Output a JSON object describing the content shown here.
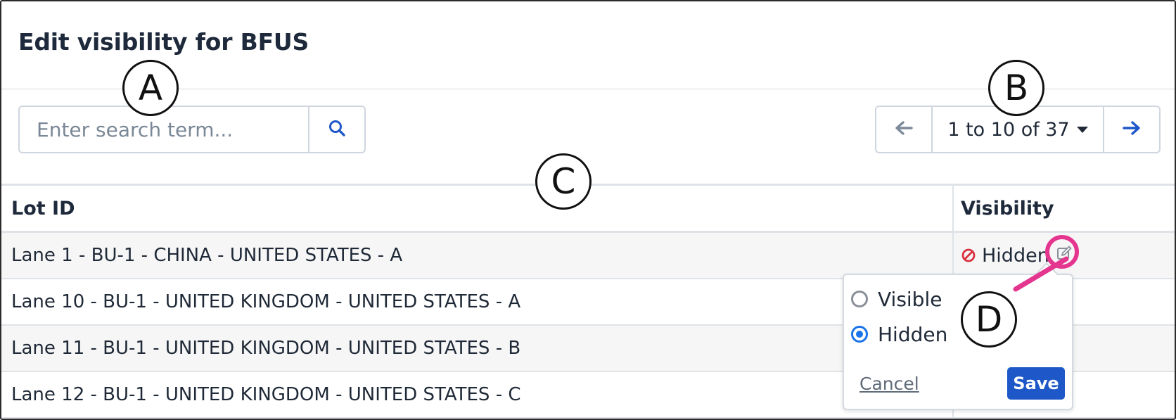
{
  "page": {
    "title": "Edit visibility for BFUS"
  },
  "search": {
    "placeholder": "Enter search term...",
    "value": ""
  },
  "pagination": {
    "range_label": "1 to 10 of 37"
  },
  "table": {
    "headers": {
      "lot_id": "Lot ID",
      "visibility": "Visibility"
    },
    "rows": [
      {
        "lot_id": "Lane 1 - BU-1 - CHINA - UNITED STATES - A",
        "visibility": "Hidden"
      },
      {
        "lot_id": "Lane 10 - BU-1 - UNITED KINGDOM - UNITED STATES - A",
        "visibility": ""
      },
      {
        "lot_id": "Lane 11 - BU-1 - UNITED KINGDOM - UNITED STATES - B",
        "visibility": ""
      },
      {
        "lot_id": "Lane 12 - BU-1 - UNITED KINGDOM - UNITED STATES - C",
        "visibility": ""
      }
    ]
  },
  "popover": {
    "options": [
      {
        "label": "Visible",
        "selected": false
      },
      {
        "label": "Hidden",
        "selected": true
      }
    ],
    "cancel_label": "Cancel",
    "save_label": "Save"
  },
  "callouts": {
    "a": "A",
    "b": "B",
    "c": "C",
    "d": "D"
  },
  "colors": {
    "accent_blue": "#1e57c7",
    "hidden_red": "#d93040",
    "callout_pink": "#e4358f",
    "radio_blue": "#1a73e8"
  },
  "icons": {
    "search": "search-icon",
    "prev": "arrow-left-icon",
    "next": "arrow-right-icon",
    "dropdown": "caret-down-icon",
    "hidden": "ban-icon",
    "edit": "edit-icon"
  }
}
